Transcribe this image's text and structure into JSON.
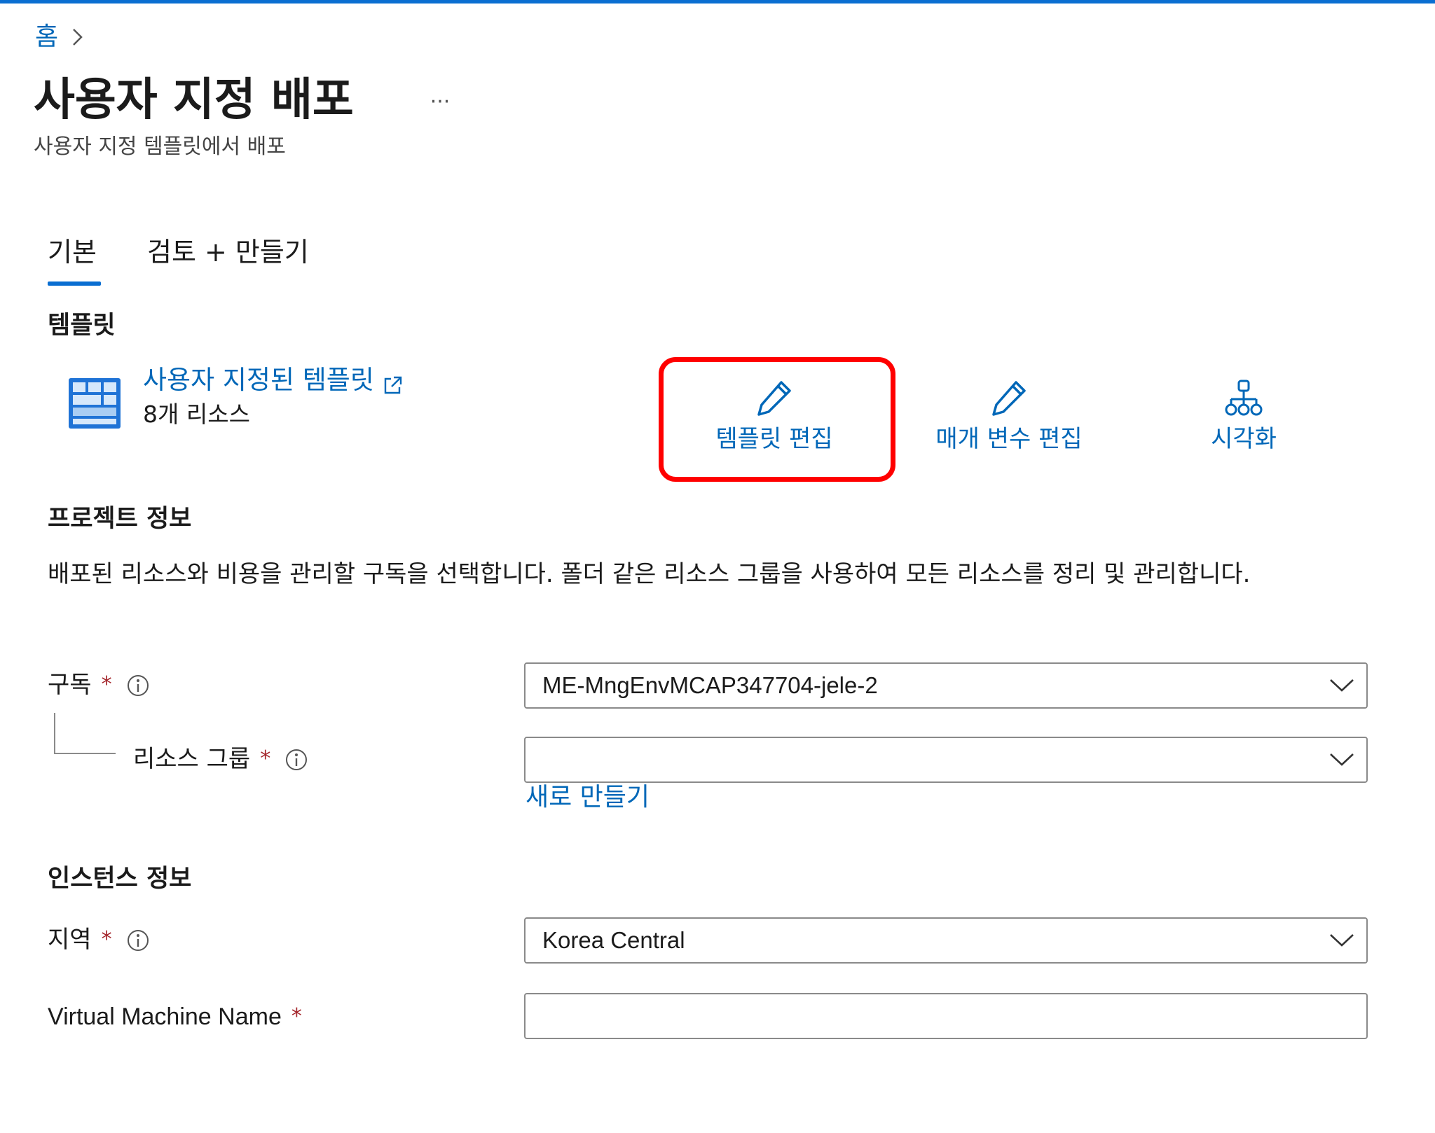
{
  "breadcrumb": {
    "home_label": "홈",
    "separator_icon": "chevron-right-icon"
  },
  "header": {
    "title": "사용자 지정 배포",
    "more_label": "···",
    "subtitle": "사용자 지정 템플릿에서 배포"
  },
  "tabs": [
    {
      "label": "기본",
      "selected": true
    },
    {
      "label": "검토 + 만들기",
      "selected": false
    }
  ],
  "template_section": {
    "heading": "템플릿",
    "icon": "template-grid-icon",
    "link_label": "사용자 지정된 템플릿",
    "link_icon": "external-link-icon",
    "resource_count": "8개 리소스",
    "actions": [
      {
        "label": "템플릿 편집",
        "icon": "pencil-icon",
        "highlighted": true
      },
      {
        "label": "매개 변수 편집",
        "icon": "pencil-icon",
        "highlighted": false
      },
      {
        "label": "시각화",
        "icon": "hierarchy-icon",
        "highlighted": false
      }
    ]
  },
  "project_details": {
    "heading": "프로젝트 정보",
    "description": "배포된 리소스와 비용을 관리할 구독을 선택합니다. 폴더 같은 리소스 그룹을 사용하여 모든 리소스를 정리 및 관리합니다.",
    "subscription": {
      "label": "구독",
      "required_mark": "*",
      "value": "ME-MngEnvMCAP347704-jele-2"
    },
    "resource_group": {
      "label": "리소스 그룹",
      "required_mark": "*",
      "value": "",
      "create_new_label": "새로 만들기"
    }
  },
  "instance_details": {
    "heading": "인스턴스 정보",
    "region": {
      "label": "지역",
      "required_mark": "*",
      "value": "Korea Central"
    },
    "vm_name": {
      "label": "Virtual Machine Name",
      "required_mark": "*",
      "value": ""
    }
  },
  "colors": {
    "accent": "#0a6ed1",
    "link": "#0067b8",
    "required": "#a4262c",
    "highlight_box": "#ff0000"
  }
}
